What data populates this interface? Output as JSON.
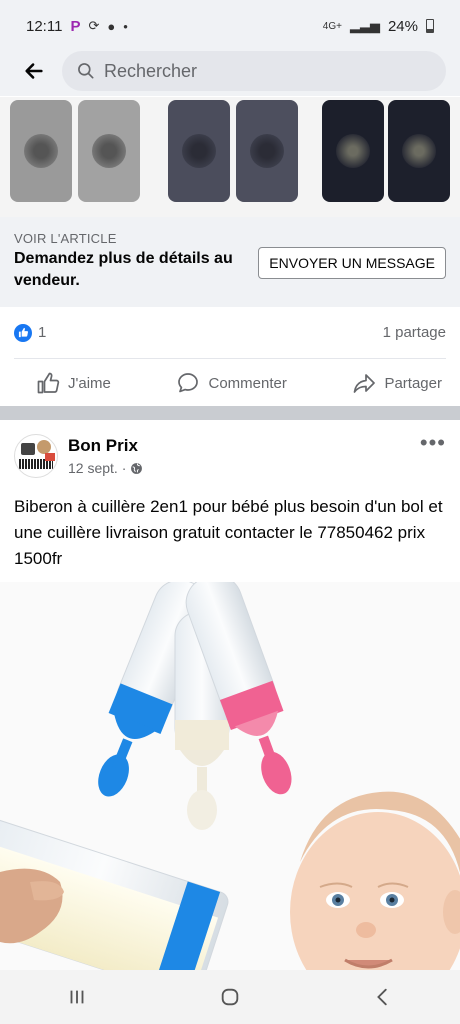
{
  "status_bar": {
    "time": "12:11",
    "network": "4G+",
    "battery": "24%"
  },
  "header": {
    "search_placeholder": "Rechercher"
  },
  "cta": {
    "label": "VOIR L'ARTICLE",
    "title": "Demandez plus de détails au vendeur.",
    "button": "ENVOYER UN MESSAGE"
  },
  "reactions": {
    "like_count": "1",
    "share_count": "1 partage"
  },
  "actions": {
    "like": "J'aime",
    "comment": "Commenter",
    "share": "Partager"
  },
  "post": {
    "page_name": "Bon Prix",
    "date": "12 sept. ·",
    "text": "Biberon à cuillère 2en1 pour bébé plus besoin d'un bol et une cuillère livraison gratuit contacter le 77850462 prix 1500fr"
  },
  "colors": {
    "brand_blue": "#1877f2",
    "pink": "#f06292",
    "spoon_blue": "#1e88e5"
  },
  "icons": [
    "back-arrow-icon",
    "search-icon",
    "like-icon",
    "comment-icon",
    "share-icon",
    "globe-icon",
    "more-icon"
  ]
}
